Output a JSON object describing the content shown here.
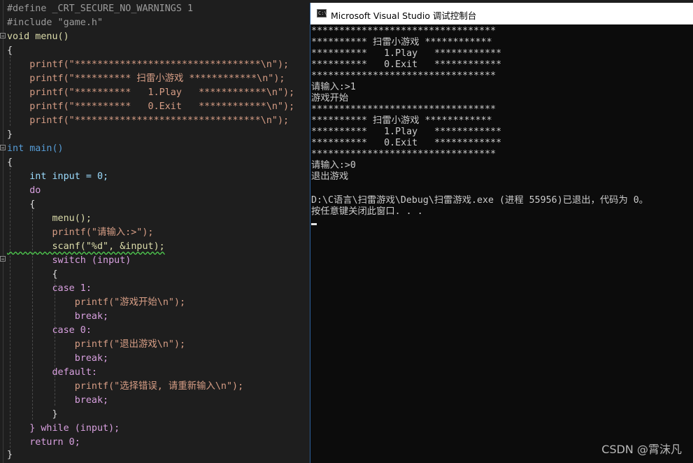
{
  "editor": {
    "lines": [
      [
        "#define _CRT_SECURE_NO_WARNINGS 1"
      ],
      [
        "#include \"game.h\""
      ],
      [
        "void menu()"
      ],
      [
        "{"
      ],
      [
        "    printf(\"*********************************\\n\");"
      ],
      [
        "    printf(\"********** 扫雷小游戏 ************\\n\");"
      ],
      [
        "    printf(\"**********   1.Play   ************\\n\");"
      ],
      [
        "    printf(\"**********   0.Exit   ************\\n\");"
      ],
      [
        "    printf(\"*********************************\\n\");"
      ],
      [
        "}"
      ],
      [
        "int main()"
      ],
      [
        "{"
      ],
      [
        "    int input = 0;"
      ],
      [
        "    do"
      ],
      [
        "    {"
      ],
      [
        "        menu();"
      ],
      [
        "        printf(\"请输入:>\");"
      ],
      [
        "        scanf(\"%d\", &input);"
      ],
      [
        "        switch (input)"
      ],
      [
        "        {"
      ],
      [
        "        case 1:"
      ],
      [
        "            printf(\"游戏开始\\n\");"
      ],
      [
        "            break;"
      ],
      [
        "        case 0:"
      ],
      [
        "            printf(\"退出游戏\\n\");"
      ],
      [
        "            break;"
      ],
      [
        "        default:"
      ],
      [
        "            printf(\"选择错误, 请重新输入\\n\");"
      ],
      [
        "            break;"
      ],
      [
        "        }"
      ],
      [
        "    } while (input);"
      ],
      [
        "    return 0;"
      ],
      [
        "}"
      ]
    ]
  },
  "console": {
    "title": "Microsoft Visual Studio 调试控制台",
    "icon_label": "C:\\",
    "output": [
      "*********************************",
      "********** 扫雷小游戏 ************",
      "**********   1.Play   ************",
      "**********   0.Exit   ************",
      "*********************************",
      "请输入:>1",
      "游戏开始",
      "*********************************",
      "********** 扫雷小游戏 ************",
      "**********   1.Play   ************",
      "**********   0.Exit   ************",
      "*********************************",
      "请输入:>0",
      "退出游戏",
      "",
      "D:\\C语言\\扫雷游戏\\Debug\\扫雷游戏.exe (进程 55956)已退出，代码为 0。",
      "按任意键关闭此窗口. . ."
    ]
  },
  "watermark": "CSDN @霄沫凡",
  "colors": {
    "keyword": "#569cd6",
    "function": "#dcdcaa",
    "string": "#d69d85",
    "variable": "#9cdcfe",
    "console_bg": "#0c0c0c",
    "editor_bg": "#1e1e1e"
  }
}
